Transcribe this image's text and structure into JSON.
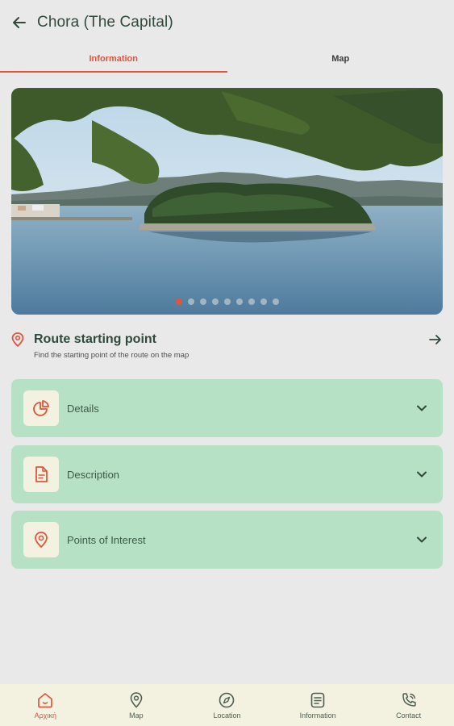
{
  "header": {
    "title": "Chora (The Capital)",
    "back_icon": "arrow-left-icon"
  },
  "tabs": [
    {
      "label": "Information",
      "active": true
    },
    {
      "label": "Map",
      "active": false
    }
  ],
  "carousel": {
    "total_slides": 9,
    "active_index": 0
  },
  "route": {
    "title": "Route starting point",
    "subtitle": "Find the starting point of the route on the map",
    "icon": "location-pin-icon",
    "action_icon": "arrow-right-icon"
  },
  "sections": [
    {
      "label": "Details",
      "icon": "pie-chart-icon"
    },
    {
      "label": "Description",
      "icon": "document-icon"
    },
    {
      "label": "Points of Interest",
      "icon": "location-pin-icon"
    }
  ],
  "bottom_nav": [
    {
      "label": "Αρχική",
      "icon": "home-icon",
      "active": true
    },
    {
      "label": "Map",
      "icon": "map-pin-icon",
      "active": false
    },
    {
      "label": "Location",
      "icon": "compass-icon",
      "active": false
    },
    {
      "label": "Information",
      "icon": "info-list-icon",
      "active": false
    },
    {
      "label": "Contact",
      "icon": "phone-icon",
      "active": false
    }
  ],
  "colors": {
    "accent": "#e0553d",
    "card_green": "#b7e1c4",
    "background": "#e9e9e9",
    "nav_background": "#f3f1df",
    "text_dark_green": "#2d4a3a"
  }
}
